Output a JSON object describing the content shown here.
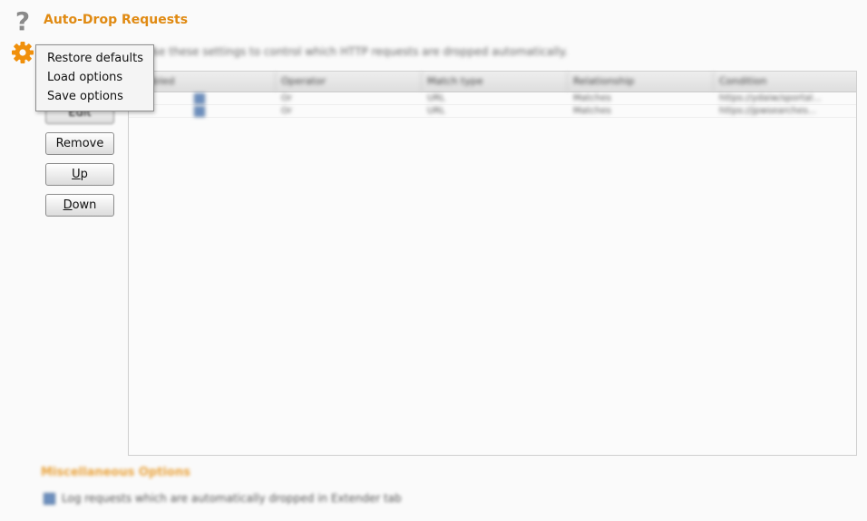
{
  "page": {
    "title": "Auto-Drop Requests",
    "description": "Use these settings to control which HTTP requests are dropped automatically."
  },
  "icons": {
    "help": "question-mark-icon",
    "settings": "gear-icon",
    "help_glyph": "?"
  },
  "colors": {
    "accent": "#e08a12",
    "gear": "#f0900c",
    "checkbox": "#6d8fbe"
  },
  "settings_menu": {
    "items": [
      {
        "label": "Restore defaults"
      },
      {
        "label": "Load options"
      },
      {
        "label": "Save options"
      }
    ]
  },
  "buttons": {
    "edit": "Edit",
    "remove": "Remove",
    "up_mnemonic": "U",
    "up_rest": "p",
    "down_mnemonic": "D",
    "down_rest": "own"
  },
  "table": {
    "columns": [
      "Enabled",
      "Operator",
      "Match type",
      "Relationship",
      "Condition"
    ],
    "rows": [
      {
        "enabled": true,
        "operator": "Or",
        "match_type": "URL",
        "relationship": "Matches",
        "condition": "https://ydaiw/sportal..."
      },
      {
        "enabled": true,
        "operator": "Or",
        "match_type": "URL",
        "relationship": "Matches",
        "condition": "https://jpwsearches..."
      }
    ]
  },
  "misc": {
    "title": "Miscellaneous Options",
    "log_label": "Log requests which are automatically dropped in Extender tab",
    "log_checked": true
  }
}
